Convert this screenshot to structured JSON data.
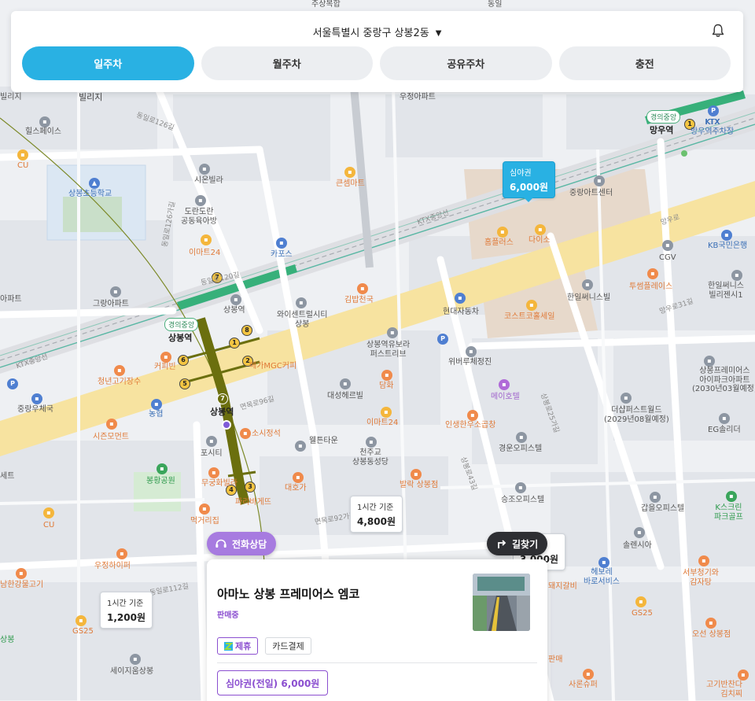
{
  "header": {
    "location": "서울특별시 중랑구 상봉2동",
    "tabs": [
      {
        "label": "일주차",
        "active": true
      },
      {
        "label": "월주차",
        "active": false
      },
      {
        "label": "공유주차",
        "active": false
      },
      {
        "label": "충전",
        "active": false
      }
    ]
  },
  "colors": {
    "accent": "#29b1e3",
    "purple": "#8b4fd0",
    "dark": "#2e2f33"
  },
  "price_markers": [
    {
      "label": "심야권",
      "price": "6,000원",
      "selected": true
    },
    {
      "label": "1시간 기준",
      "price": "4,800원",
      "selected": false
    },
    {
      "label": "1시간 기준",
      "price": "1,200원",
      "selected": false
    },
    {
      "label": "준",
      "price": "3,000원",
      "selected": false
    }
  ],
  "buttons": {
    "phone": "전화상담",
    "route": "길찾기"
  },
  "card": {
    "title": "아마노 상봉 프레미어스 엠코",
    "status": "판매중",
    "chips": [
      "제휴",
      "카드결제"
    ],
    "pass": "심야권(전일) 6,000원"
  },
  "map": {
    "stations": [
      {
        "name": "상봉역",
        "line_tag": "경의중앙"
      },
      {
        "name": "망우역",
        "line_tag": "경의중앙"
      },
      {
        "name": "상봉역",
        "line_tag": ""
      }
    ],
    "labels": {
      "a1": "주상복합",
      "a2": "동일",
      "a3": "빌리지",
      "a4": "힐스페이스",
      "a5": "CU",
      "a6": "상봉초등학교",
      "a7": "시온빌라",
      "a8": "도란도란\n공동육아방",
      "a9": "이마트24",
      "a10": "그랑아파트",
      "a11": "상봉역",
      "a12": "커피빈",
      "a13": "청년고기장수",
      "a14": "중랑우체국",
      "a15": "농협",
      "a16": "시즌모먼트",
      "a17": "포시티",
      "a18": "봉황공원",
      "a19": "무궁화빌라",
      "a20": "먹거리집",
      "a21": "CU",
      "a22": "우정하이퍼",
      "a23": "남한강물고기",
      "a24": "GS25",
      "a25": "세이지움상봉",
      "b1": "큰셈마트",
      "b2": "카포스",
      "b3": "와이센트럴시티\n상봉",
      "b4": "김밥천국",
      "b5": "메가MGC커피",
      "b6": "소시정석",
      "b7": "대성헤르빌",
      "b8": "이마트24",
      "b9": "담화",
      "b10": "웰튼타운",
      "b11": "천주교\n상봉동성당",
      "b12": "대호가",
      "b13": "파리바게뜨",
      "b14": "발락 상봉점",
      "b15": "상봉역유보라\n퍼스트리브",
      "b16": "현대자동차",
      "b17": "위버루체정진",
      "b18": "메이호텔",
      "b19": "인생한우소곱창",
      "b20": "경운오피스텔",
      "b21": "승조오피스텔",
      "b22": "우정아파트",
      "c1": "홈플러스",
      "c2": "다이소",
      "c3": "중랑아트센터",
      "c4": "한일써니스빌",
      "c5": "코스트코홀세일",
      "c6": "더샵퍼스트월드\n(2029년08월예정)",
      "c7": "KTX\n망우역주차장",
      "c8": "KB국민은행",
      "c9": "CGV",
      "c10": "투썸플레이스",
      "c11": "한일써니스\n빌리젠시1",
      "c12": "상봉프레미어스\n아이파크아파트\n(2030년03월예정)",
      "c13": "EG솔리더",
      "c14": "갑을오피스텔",
      "c15": "K스크린\n파크골프",
      "c16": "솔렌시아",
      "c17": "헤보레\n바로서비스",
      "c18": "돼지갈비",
      "c19": "GS25",
      "c20": "서부청기와\n감자탕",
      "c21": "오선 상봉점",
      "c22": "사론슈퍼",
      "c23": "고기반찬다\n김치찌",
      "c24": "판매",
      "c25": "빌리지",
      "c26": "아파트",
      "c27": "래미안",
      "c28": "세트",
      "c29": "상봉",
      "c30": "KTX"
    },
    "roads": [
      "동일로126길",
      "동일로120길",
      "동일로126가길",
      "상봉로",
      "망우로",
      "상봉로25가길",
      "면목로92가길",
      "면목로96길",
      "KTX중앙선",
      "망우로31길",
      "상봉로43길",
      "동일로112길",
      "봉우재로"
    ]
  }
}
